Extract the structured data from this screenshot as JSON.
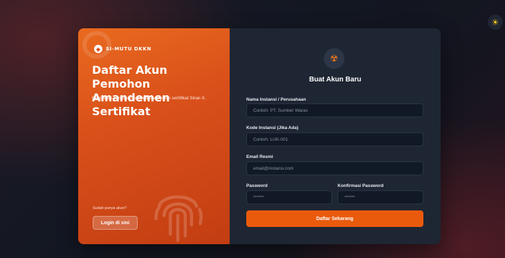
{
  "theme_toggle": {
    "icon": "sun-icon",
    "glyph": "☀"
  },
  "left_panel": {
    "brand": "SI-MUTU DKKN",
    "brand_icon": "shield-icon",
    "title_line1": "Daftar Akun Pemohon",
    "title_line2": "Amandemen Sertifikat",
    "description": "Registrasi pemohon untuk amandemen sertifikat Sinar-X.",
    "login_hint": "Sudah punya akun?",
    "login_button": "Login di sini",
    "decor_icon": "fingerprint-icon"
  },
  "form": {
    "logo_icon": "radiation-icon",
    "logo_glyph": "☢",
    "title": "Buat Akun Baru",
    "fields": {
      "instansi_label": "Nama Instansi / Perusahaan",
      "instansi_placeholder": "Contoh: PT. Sumber Waras",
      "kode_label": "Kode Instansi (Jika Ada)",
      "kode_placeholder": "Contoh: LUK-001",
      "email_label": "Email Resmi",
      "email_placeholder": "email@instansi.com",
      "password_label": "Password",
      "password_placeholder": "******",
      "confirm_label": "Konfirmasi Password",
      "confirm_placeholder": "******"
    },
    "submit_label": "Daftar Sekarang"
  },
  "colors": {
    "accent": "#ea5a0d",
    "panel_dark": "#1e2633",
    "input_bg": "#111826",
    "sun": "#f5c518"
  }
}
